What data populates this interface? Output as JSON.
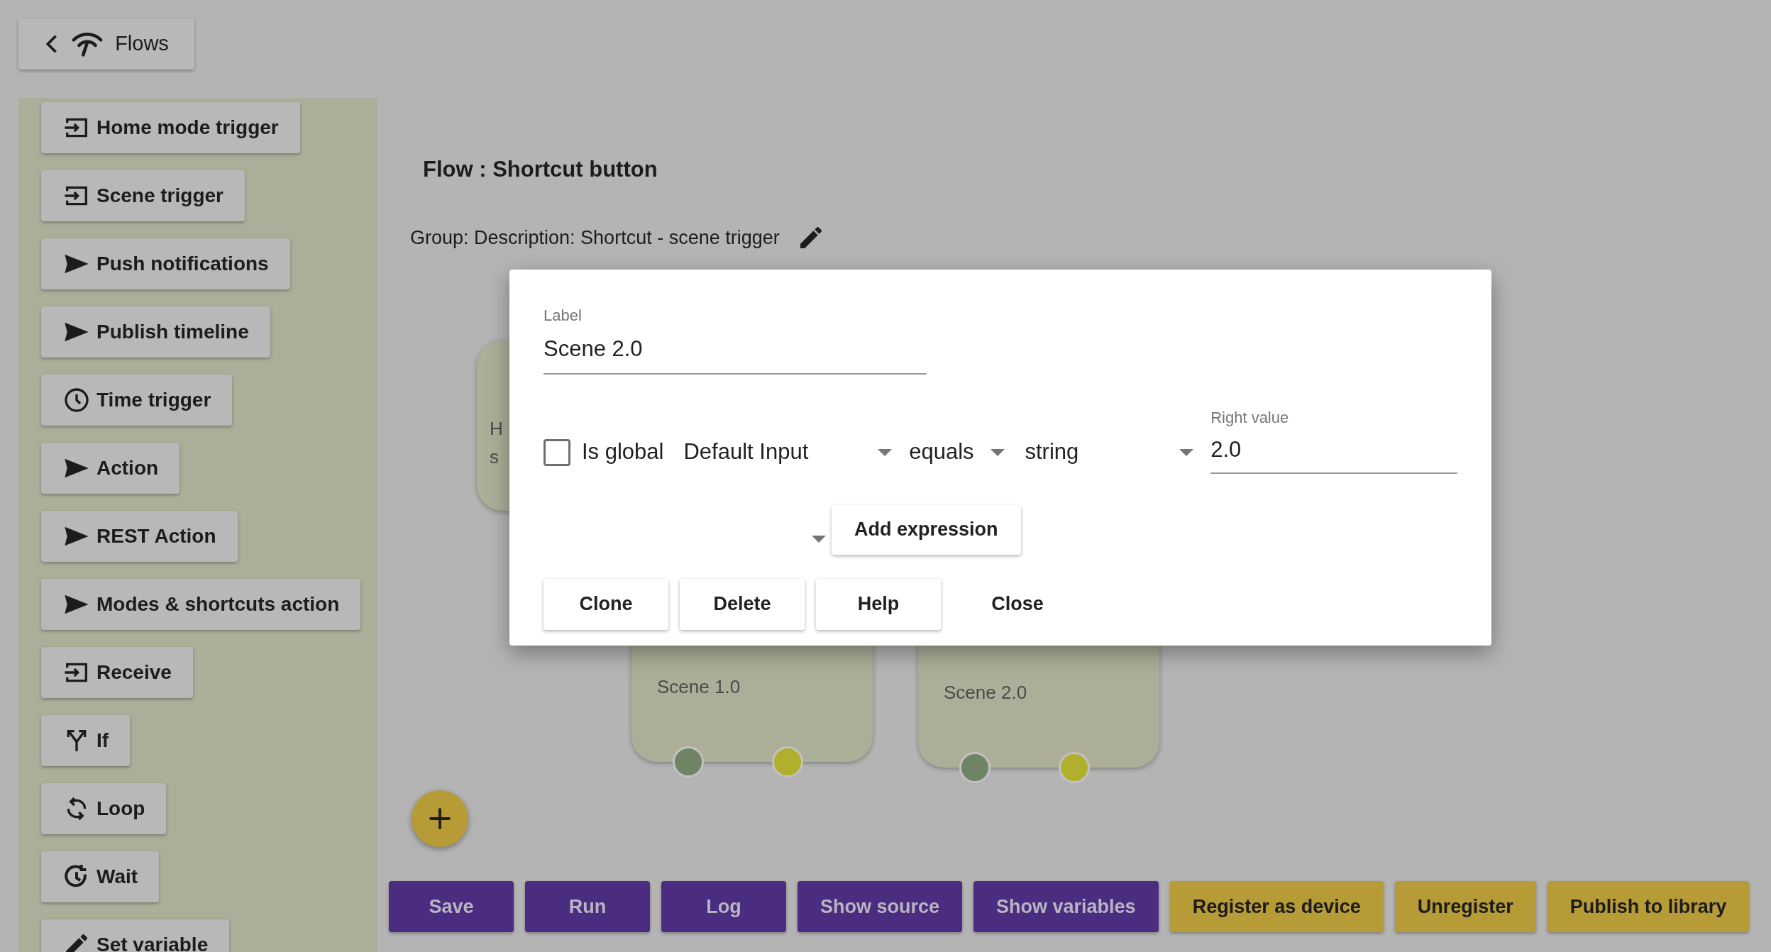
{
  "header": {
    "back_button": "Flows"
  },
  "sidebar": {
    "items": [
      {
        "label": "Home mode trigger",
        "kind": "input"
      },
      {
        "label": "Scene trigger",
        "kind": "input"
      },
      {
        "label": "Push notifications",
        "kind": "send"
      },
      {
        "label": "Publish timeline",
        "kind": "send"
      },
      {
        "label": "Time trigger",
        "kind": "clock"
      },
      {
        "label": "Action",
        "kind": "send"
      },
      {
        "label": "REST Action",
        "kind": "send"
      },
      {
        "label": "Modes & shortcuts action",
        "kind": "send"
      },
      {
        "label": "Receive",
        "kind": "input"
      },
      {
        "label": "If",
        "kind": "fork"
      },
      {
        "label": "Loop",
        "kind": "loop"
      },
      {
        "label": "Wait",
        "kind": "wait"
      },
      {
        "label": "Set variable",
        "kind": "pencil"
      }
    ]
  },
  "flow": {
    "title": "Flow : Shortcut button",
    "group": "Group: Description: Shortcut - scene trigger"
  },
  "canvas": {
    "nodes": [
      {
        "lines": [
          "H",
          "s"
        ]
      },
      {
        "lines": [
          "Scene 1.0"
        ],
        "ports": [
          {
            "color": "#6f8465"
          },
          {
            "color": "#b0b02c"
          }
        ]
      },
      {
        "lines": [
          "Scene 2.0"
        ],
        "ports": [
          {
            "color": "#6f8465"
          },
          {
            "color": "#b0b02c"
          }
        ]
      }
    ]
  },
  "dialog": {
    "label_field": {
      "label": "Label",
      "value": "Scene 2.0"
    },
    "is_global": {
      "label": "Is global",
      "checked": false
    },
    "left_select": "Default Input",
    "operator_select": "equals",
    "type_select": "string",
    "right_value": {
      "label": "Right value",
      "value": "2.0"
    },
    "add_expression": "Add expression",
    "buttons": [
      {
        "label": "Clone",
        "kind": "raised"
      },
      {
        "label": "Delete",
        "kind": "raised"
      },
      {
        "label": "Help",
        "kind": "raised"
      },
      {
        "label": "Close",
        "kind": "flat"
      }
    ]
  },
  "toolbar": {
    "buttons": [
      {
        "label": "Save",
        "kind": "primary"
      },
      {
        "label": "Run",
        "kind": "primary"
      },
      {
        "label": "Log",
        "kind": "primary"
      },
      {
        "label": "Show source",
        "kind": "primary"
      },
      {
        "label": "Show variables",
        "kind": "primary"
      },
      {
        "label": "Register as device",
        "kind": "secondary"
      },
      {
        "label": "Unregister",
        "kind": "secondary"
      },
      {
        "label": "Publish to library",
        "kind": "secondary"
      }
    ]
  }
}
